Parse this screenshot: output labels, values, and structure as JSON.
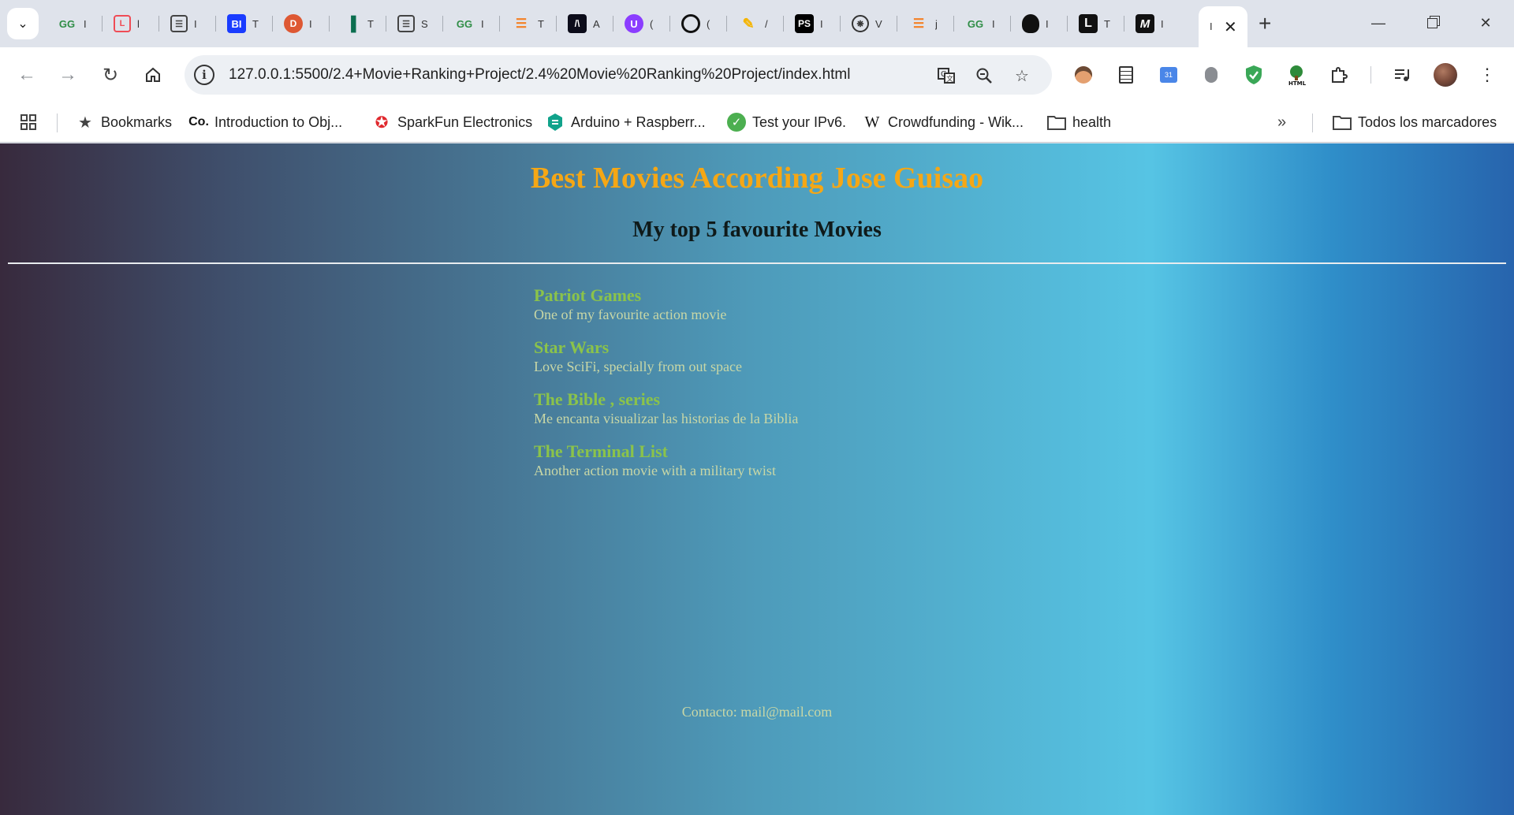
{
  "browser": {
    "tabs": [
      {
        "icon": "geeksforgeeks-icon",
        "title": "I"
      },
      {
        "icon": "laravel-icon",
        "title": "l"
      },
      {
        "icon": "reader-icon",
        "title": "I"
      },
      {
        "icon": "bi-icon",
        "title": "T"
      },
      {
        "icon": "duckduckgo-icon",
        "title": "I"
      },
      {
        "icon": "chart-icon",
        "title": "T"
      },
      {
        "icon": "reader-icon",
        "title": "S"
      },
      {
        "icon": "geeksforgeeks-icon",
        "title": "I"
      },
      {
        "icon": "stackoverflow-icon",
        "title": "T"
      },
      {
        "icon": "code-icon",
        "title": "A"
      },
      {
        "icon": "u-icon",
        "title": "("
      },
      {
        "icon": "github-icon",
        "title": "("
      },
      {
        "icon": "pen-icon",
        "title": "/"
      },
      {
        "icon": "ps-icon",
        "title": "I"
      },
      {
        "icon": "openai-icon",
        "title": "V"
      },
      {
        "icon": "stackoverflow-icon",
        "title": "j"
      },
      {
        "icon": "geeksforgeeks-icon",
        "title": "I"
      },
      {
        "icon": "head-icon",
        "title": "I"
      },
      {
        "icon": "l-icon",
        "title": "T"
      },
      {
        "icon": "m-icon",
        "title": "I"
      }
    ],
    "active_tab": {
      "title": "I"
    },
    "url": "127.0.0.1:5500/2.4+Movie+Ranking+Project/2.4%20Movie%20Ranking%20Project/index.html",
    "bookmarks": [
      {
        "icon": "star-icon",
        "label": "Bookmarks"
      },
      {
        "icon": "coursera-icon",
        "label": "Introduction to Obj..."
      },
      {
        "icon": "sparkfun-icon",
        "label": "SparkFun Electronics"
      },
      {
        "icon": "shield-icon",
        "label": "Arduino + Raspberr..."
      },
      {
        "icon": "check-icon",
        "label": "Test your IPv6."
      },
      {
        "icon": "wikipedia-icon",
        "label": "Crowdfunding - Wik..."
      },
      {
        "icon": "folder-icon",
        "label": "health"
      }
    ],
    "all_bookmarks_label": "Todos los marcadores"
  },
  "page": {
    "title": "Best Movies According Jose Guisao",
    "subtitle": "My top 5 favourite Movies",
    "movies": [
      {
        "title": "Patriot Games",
        "description": "One of my favourite action movie"
      },
      {
        "title": "Star Wars",
        "description": "Love SciFi, specially from out space"
      },
      {
        "title": "The Bible , series",
        "description": "Me encanta visualizar las historias de la Biblia"
      },
      {
        "title": "The Terminal List",
        "description": "Another action movie with a military twist"
      }
    ],
    "contact_label": "Contacto:",
    "contact_email": "mail@mail.com"
  },
  "colors": {
    "title": "#f5a715",
    "movie_title": "#8bc34a",
    "movie_text": "#c8d7a6"
  }
}
